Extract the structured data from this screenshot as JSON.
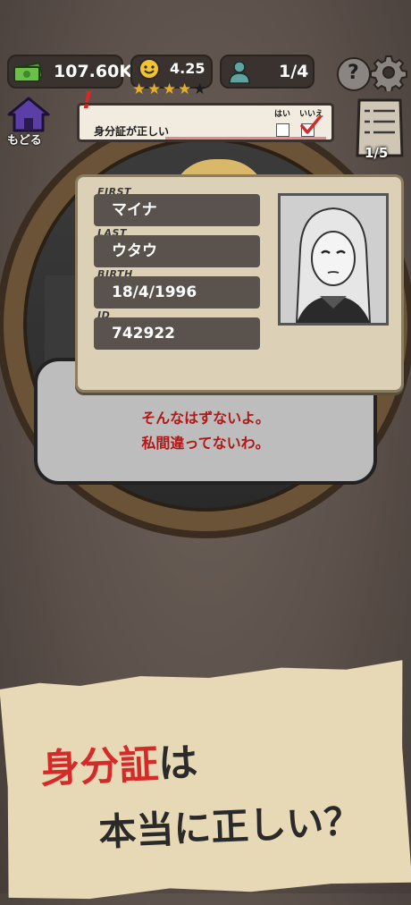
{
  "stats": {
    "money": "107.60K",
    "rating": "4.25",
    "rating_stars": 4,
    "customers": "1/4"
  },
  "nav": {
    "back_label": "もどる",
    "checklist_count": "1/5"
  },
  "task": {
    "question": "身分証が正しい",
    "yes_label": "はい",
    "no_label": "いいえ",
    "selected": "いいえ"
  },
  "id_card": {
    "fields": [
      {
        "label": "FIRST",
        "value": "マイナ"
      },
      {
        "label": "LAST",
        "value": "ウタウ"
      },
      {
        "label": "BIRTH",
        "value": "18/4/1996"
      },
      {
        "label": "ID",
        "value": "742922"
      }
    ]
  },
  "dialogue": {
    "line1": "そんなはずないよ。",
    "line2": "私間違ってないわ。"
  },
  "banner": {
    "highlight": "身分証",
    "line1_rest": "は",
    "line2": "本当に正しい？"
  },
  "colors": {
    "accent_red": "#d42a2a",
    "card_bg": "#dcd1b6",
    "paper": "#e7d8b6"
  }
}
